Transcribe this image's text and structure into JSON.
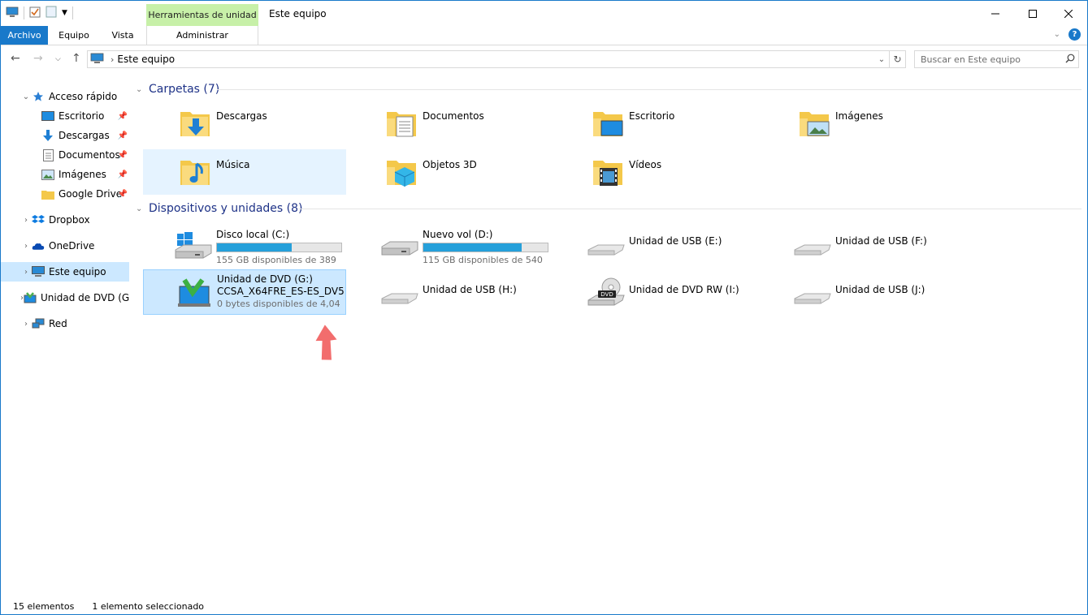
{
  "window": {
    "title": "Este equipo",
    "context_tab": "Herramientas de unidad"
  },
  "ribbon": {
    "tabs": [
      "Archivo",
      "Equipo",
      "Vista"
    ],
    "context_subtab": "Administrar"
  },
  "nav": {
    "address": "Este equipo",
    "search_placeholder": "Buscar en Este equipo"
  },
  "sidebar": {
    "items": [
      {
        "label": "Acceso rápido",
        "icon": "star-icon"
      },
      {
        "label": "Escritorio",
        "icon": "desktop-icon",
        "pinned": true
      },
      {
        "label": "Descargas",
        "icon": "download-icon",
        "pinned": true
      },
      {
        "label": "Documentos",
        "icon": "documents-icon",
        "pinned": true
      },
      {
        "label": "Imágenes",
        "icon": "pictures-icon",
        "pinned": true
      },
      {
        "label": "Google Drive",
        "icon": "folder-icon",
        "pinned": true
      },
      {
        "label": "Dropbox",
        "icon": "dropbox-icon"
      },
      {
        "label": "OneDrive",
        "icon": "onedrive-icon"
      },
      {
        "label": "Este equipo",
        "icon": "computer-icon"
      },
      {
        "label": "Unidad de DVD (G:",
        "icon": "dvd-icon"
      },
      {
        "label": "Red",
        "icon": "network-icon"
      }
    ]
  },
  "folders": {
    "header": "Carpetas (7)",
    "items": [
      "Descargas",
      "Documentos",
      "Escritorio",
      "Imágenes",
      "Música",
      "Objetos 3D",
      "Vídeos"
    ]
  },
  "devices": {
    "header": "Dispositivos y unidades (8)",
    "items": [
      {
        "name": "Disco local (C:)",
        "free": "155 GB disponibles de 389",
        "used_fraction": 0.6
      },
      {
        "name": "Nuevo vol (D:)",
        "free": "115 GB disponibles de 540",
        "used_fraction": 0.79
      },
      {
        "name": "Unidad de USB (E:)"
      },
      {
        "name": "Unidad de USB (F:)"
      },
      {
        "name": "Unidad de DVD (G:)",
        "volume": "CCSA_X64FRE_ES-ES_DV5",
        "free": "0 bytes disponibles de 4,04"
      },
      {
        "name": "Unidad de USB (H:)"
      },
      {
        "name": "Unidad de DVD RW (I:)"
      },
      {
        "name": "Unidad de USB (J:)"
      }
    ]
  },
  "status": {
    "count": "15 elementos",
    "selected": "1 elemento seleccionado"
  },
  "colors": {
    "accent": "#1979ca",
    "selection": "#cce8ff",
    "progress": "#26a0da",
    "context_tab": "#c7f0a8",
    "arrow": "#f26d6d"
  }
}
